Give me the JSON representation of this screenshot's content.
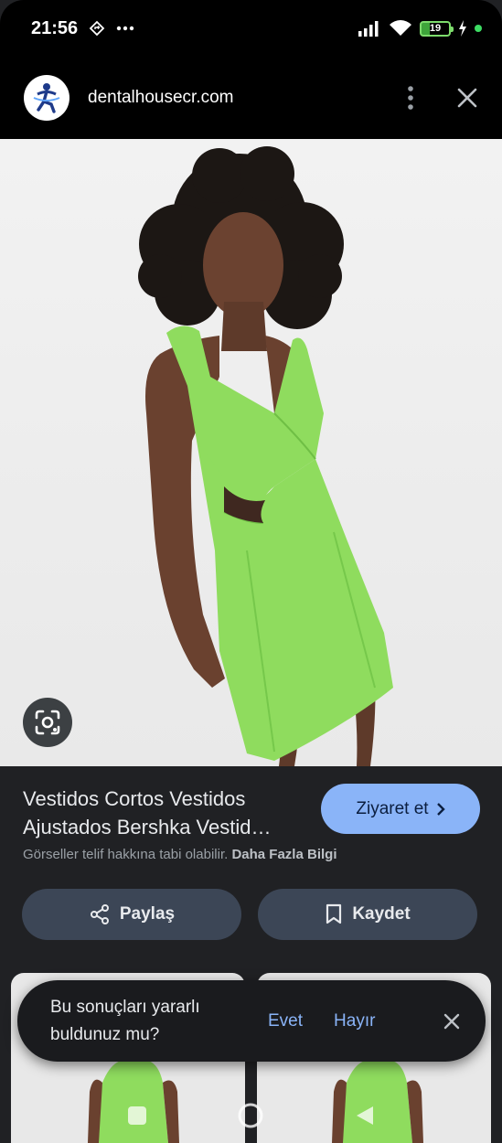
{
  "status_bar": {
    "time": "21:56",
    "battery": "19",
    "icons": [
      "navigation-icon",
      "more-dots-icon",
      "signal-icon",
      "wifi-icon",
      "battery-icon",
      "charging-icon",
      "privacy-dot-icon"
    ]
  },
  "header": {
    "domain": "dentalhousecr.com",
    "icons": [
      "site-logo-icon",
      "more-vert-icon",
      "close-icon"
    ]
  },
  "result": {
    "title": "Vestidos Cortos Vestidos Ajustados Bershka Vestid…",
    "visit_label": "Ziyaret et",
    "copyright_text": "Görseller telif hakkına tabi olabilir.",
    "more_info_label": "Daha Fazla Bilgi",
    "share_label": "Paylaş",
    "save_label": "Kaydet"
  },
  "toast": {
    "question": "Bu sonuçları yararlı buldunuz mu?",
    "yes_label": "Evet",
    "no_label": "Hayır"
  },
  "colors": {
    "accent": "#8ab4f8",
    "dress": "#8fdc5e",
    "background": "#202124"
  }
}
